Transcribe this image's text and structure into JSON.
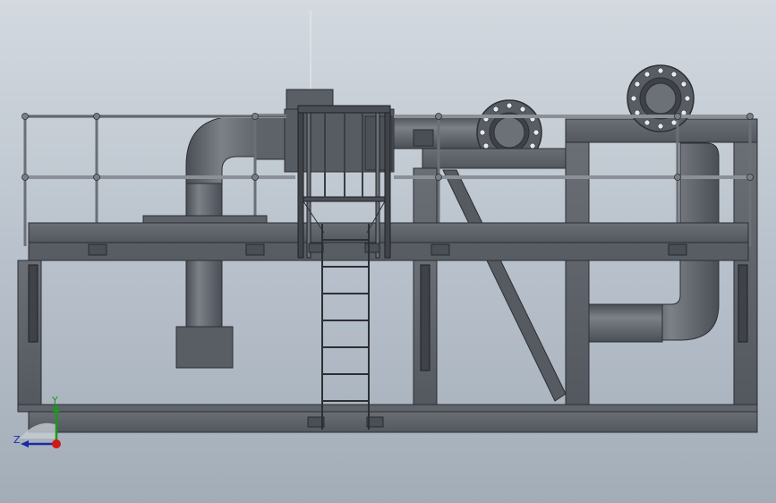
{
  "viewport": {
    "background_top": "#d3d9df",
    "background_bottom": "#a3adb8"
  },
  "model": {
    "steel_color": "#5b5f66",
    "steel_dark": "#2c2f34",
    "pipe_color": "#63676e",
    "pipe_highlight": "#8a8e95"
  },
  "triad": {
    "y_label": "Y",
    "z_label": "Z",
    "y_color": "#1a9a1a",
    "z_color": "#1a2aa8",
    "origin_color": "#d01818"
  }
}
